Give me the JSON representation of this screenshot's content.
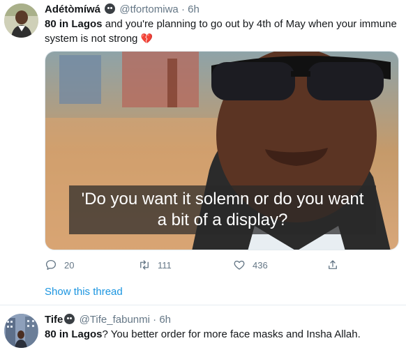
{
  "tweets": [
    {
      "name": "Adétòmíwá",
      "handle": "@tfortomiwa",
      "time": "6h",
      "text_bold": "80 in Lagos",
      "text_rest": " and you're planning to go out by 4th of May when your immune system is not strong",
      "emoji_after_text": "💔",
      "media_caption": "'Do you want it solemn or do you want a bit of a display?",
      "reply_count": "20",
      "retweet_count": "111",
      "like_count": "436",
      "show_thread": "Show this thread"
    },
    {
      "name": "Tife",
      "handle": "@Tife_fabunmi",
      "time": "6h",
      "text_bold": "80 in Lagos",
      "text_rest": "? You better order for more face masks and Insha Allah."
    }
  ],
  "separator": " · ",
  "colors": {
    "link": "#1b95e0",
    "muted": "#657786",
    "text": "#14171a",
    "heart": "#e0245e"
  },
  "icons": [
    "reply-icon",
    "retweet-icon",
    "like-icon",
    "share-icon",
    "emoji-badge-icon",
    "broken-heart-emoji"
  ]
}
